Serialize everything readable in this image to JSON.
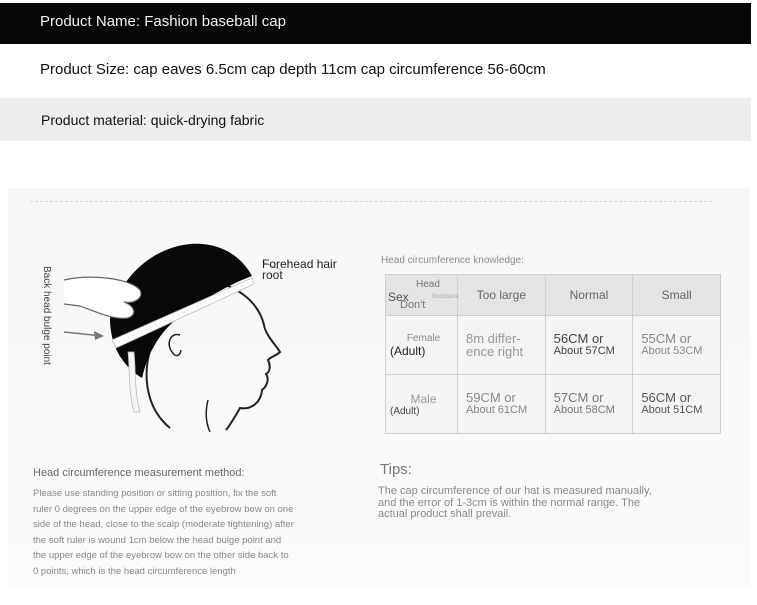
{
  "info": {
    "name": "Product Name: Fashion baseball cap",
    "size": "Product Size: cap eaves 6.5cm cap depth 11cm cap circumference 56-60cm",
    "material": "Product material: quick-drying fabric"
  },
  "diagram": {
    "back_label": "Back head bulge point",
    "forehead_label": "Forehead hair root"
  },
  "knowledge": {
    "title": "Head circumference knowledge:",
    "corner": {
      "head": "Head",
      "sex": "Sex",
      "dont": "Don't",
      "small": "Enclosure"
    },
    "columns": [
      "Too large",
      "Normal",
      "Small"
    ],
    "rows": [
      {
        "sex_top": "Female",
        "sex_bottom": "(Adult)",
        "cells": [
          {
            "line1": "8m differ-",
            "line2": "ence right"
          },
          {
            "line1": "56CM or",
            "line2": "About 57CM"
          },
          {
            "line1": "55CM or",
            "line2": "About 53CM"
          }
        ]
      },
      {
        "sex_top": "Male",
        "sex_bottom": "(Adult)",
        "cells": [
          {
            "line1": "59CM or",
            "line2": "About 61CM"
          },
          {
            "line1": "57CM or",
            "line2": "About 58CM"
          },
          {
            "line1": "56CM or",
            "line2": "About 51CM"
          }
        ]
      }
    ]
  },
  "method": {
    "title": "Head circumference measurement method:",
    "lines": [
      "Please use standing position or sitting position, fix the soft",
      "ruler 0 degrees on the upper edge of the eyebrow bow on one",
      "side of the head, close to the scalp (moderate tightening) after",
      "the soft ruler is wound 1cm below the head bulge point and",
      "the upper edge of the eyebrow bow on the other side back to",
      "0 points, which is the head circumference length"
    ]
  },
  "tips": {
    "title": "Tips:",
    "lines": [
      "The cap circumference of our hat is measured manually,",
      "and the error of 1-3cm is within the normal range. The",
      "actual product shall prevail."
    ]
  }
}
